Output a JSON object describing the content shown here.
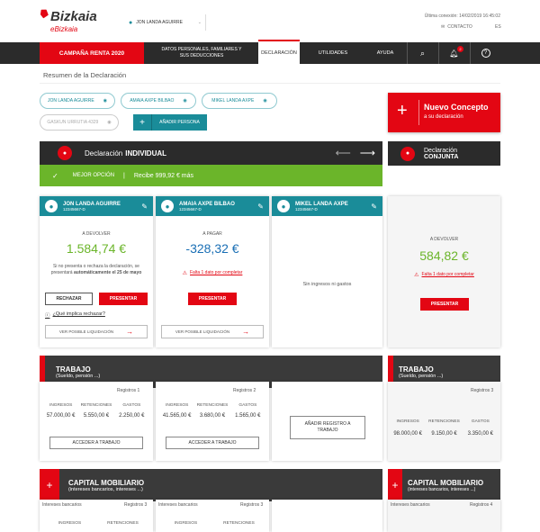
{
  "brand": {
    "name": "Bizkaia",
    "sub": "eBizkaia"
  },
  "user": {
    "name": "JON LANDA AGUIRRE"
  },
  "last_connection": "Última conexión: 14/02/2019 16:45:02",
  "contact_label": "CONTACTO",
  "lang_label": "ES",
  "nav": {
    "campaign": "CAMPAÑA RENTA 2020",
    "personal": "DATOS PERSONALES, FAMILIARES Y SUS DEDUCCIONES",
    "declaration": "DECLARACIÓN",
    "utilities": "UTILIDADES",
    "help": "AYUDA",
    "notif_count": "2"
  },
  "breadcrumb": "Resumen de la Declaración",
  "persons": [
    {
      "label": "JON LANDA AGUIRRE"
    },
    {
      "label": "AMAIA AXPE BILBAO"
    },
    {
      "label": "MIKEL LANDA AXPE"
    },
    {
      "label": "GASKUN URRUTIA 4329"
    }
  ],
  "add_person": "AÑADIR PERSONA",
  "new_concept": {
    "title": "Nuevo Concepto",
    "sub": "a su declaración"
  },
  "individual": {
    "label": "Declaración",
    "type": "INDIVIDUAL",
    "best": "MEJOR OPCIÓN",
    "receive": "Recibe 999,92 € más"
  },
  "joint": {
    "label": "Declaración",
    "type": "CONJUNTA"
  },
  "cards": [
    {
      "name": "JON LANDA AGUIRRE",
      "id": "12345667-D",
      "status": "A DEVOLVER",
      "amount": "1.584,74 €",
      "note1": "Si no presenta o rechaza la declaración, se presentará",
      "note2": "automáticamente el 25 de mayo",
      "reject": "RECHAZAR",
      "present": "PRESENTAR",
      "help": "¿Qué implica rechazar?",
      "view": "VER POSIBLE LIQUIDACIÓN"
    },
    {
      "name": "AMAIA AXPE BILBAO",
      "id": "12345667-D",
      "status": "A PAGAR",
      "amount": "-328,32 €",
      "warn": "Falta 1 dato por completar",
      "present": "PRESENTAR",
      "view": "VER POSIBLE LIQUIDACIÓN"
    },
    {
      "name": "MIKEL LANDA AXPE",
      "id": "12345667-D",
      "empty": "Sin ingresos ni gastos"
    }
  ],
  "joint_card": {
    "status": "A DEVOLVER",
    "amount": "584,82 €",
    "warn": "Falta 1 dato por completar",
    "present": "PRESENTAR"
  },
  "trabajo": {
    "title": "TRABAJO",
    "sub": "(Sueldo, pensión ...)",
    "records_label": "Registros",
    "col1": {
      "records": "1",
      "ingresos": "57.000,00 €",
      "retenciones": "5.550,00 €",
      "gastos": "2.250,00 €",
      "btn": "ACCEDER A TRABAJO"
    },
    "col2": {
      "records": "2",
      "ingresos": "41.565,00 €",
      "retenciones": "3.680,00 €",
      "gastos": "1.565,00 €",
      "btn": "ACCEDER A TRABAJO"
    },
    "col3": {
      "btn": "AÑADIR REGISTRO A TRABAJO"
    },
    "joint": {
      "records": "3",
      "ingresos": "98.000,00 €",
      "retenciones": "9.150,00 €",
      "gastos": "3.350,00 €"
    },
    "h_ingresos": "INGRESOS",
    "h_retenciones": "RETENCIONES",
    "h_gastos": "GASTOS"
  },
  "capital": {
    "title": "CAPITAL MOBILIARIO",
    "sub": "(intereses bancarios, intereses ...)",
    "subhead": "Intereses bancarios",
    "rec1": "3",
    "rec2": "3",
    "rec_joint": "4",
    "h_ingresos": "INGRESOS",
    "h_retenciones": "RETENCIONES"
  }
}
